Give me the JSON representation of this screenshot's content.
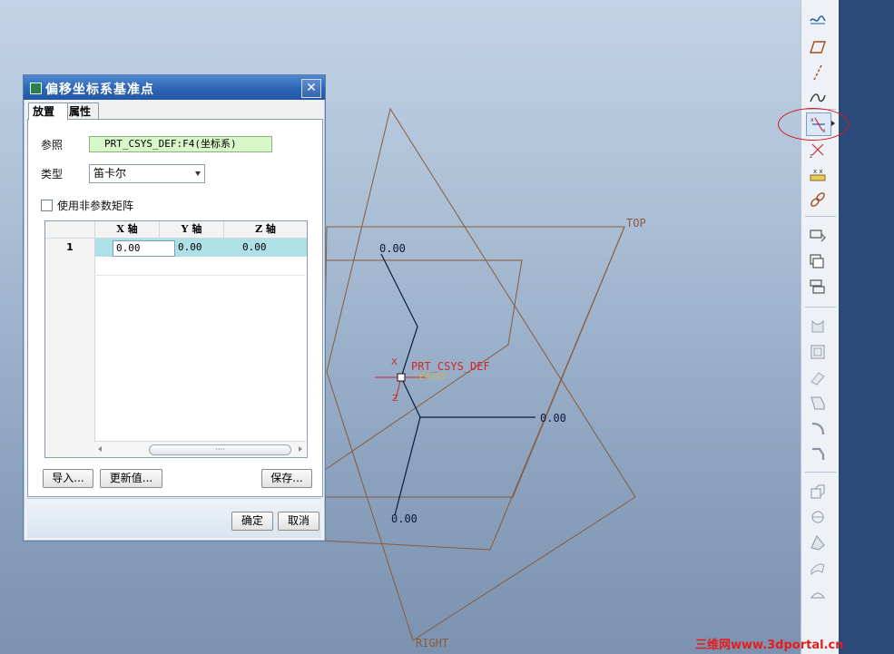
{
  "viewport": {
    "labels": {
      "top_plane": "TOP",
      "right_plane": "RIGHT",
      "csys_name": "PRT_CSYS_DEF",
      "csys_sub": "F4(IV",
      "axis_x": "X",
      "axis_z": "Z",
      "offset_top": "0.00",
      "offset_right": "0.00",
      "offset_bottom": "0.00"
    },
    "colors": {
      "plane": "#8a5a3a",
      "axis": "#0b1a3a",
      "csys": "#cc2a2a"
    }
  },
  "toolbar": {
    "icons": [
      "sketch-curve-icon",
      "plane-icon",
      "axis-icon",
      "curve-icon",
      "offset-csys-point-icon",
      "field-point-icon",
      "datum-point-array-icon",
      "chain-link-icon",
      "copy-icon",
      "paste-icon",
      "paste-special-icon",
      "extrude-icon",
      "revolve-icon",
      "sweep-icon",
      "blend-icon",
      "round-icon",
      "chamfer-icon",
      "draft-icon",
      "shell-icon",
      "rib-icon",
      "pattern-icon",
      "mirror-icon"
    ],
    "active_icon": "offset-csys-point-icon"
  },
  "watermark": "三维网www.3dportal.cn",
  "dialog": {
    "title": "偏移坐标系基准点",
    "close_symbol": "✕",
    "tabs": [
      {
        "label": "放置"
      },
      {
        "label": "属性"
      }
    ],
    "reference_label": "参照",
    "reference_value": "PRT_CSYS_DEF:F4(坐标系)",
    "type_label": "类型",
    "type_value": "笛卡尔",
    "nonparam_checkbox_label": "使用非参数矩阵",
    "grid": {
      "columns": [
        "X 轴",
        "Y 轴",
        "Z 轴"
      ],
      "rows": [
        {
          "index": "1",
          "x": "0.00",
          "y": "0.00",
          "z": "0.00"
        }
      ]
    },
    "buttons": {
      "import": "导入...",
      "update": "更新值...",
      "save": "保存...",
      "ok": "确定",
      "cancel": "取消"
    }
  }
}
